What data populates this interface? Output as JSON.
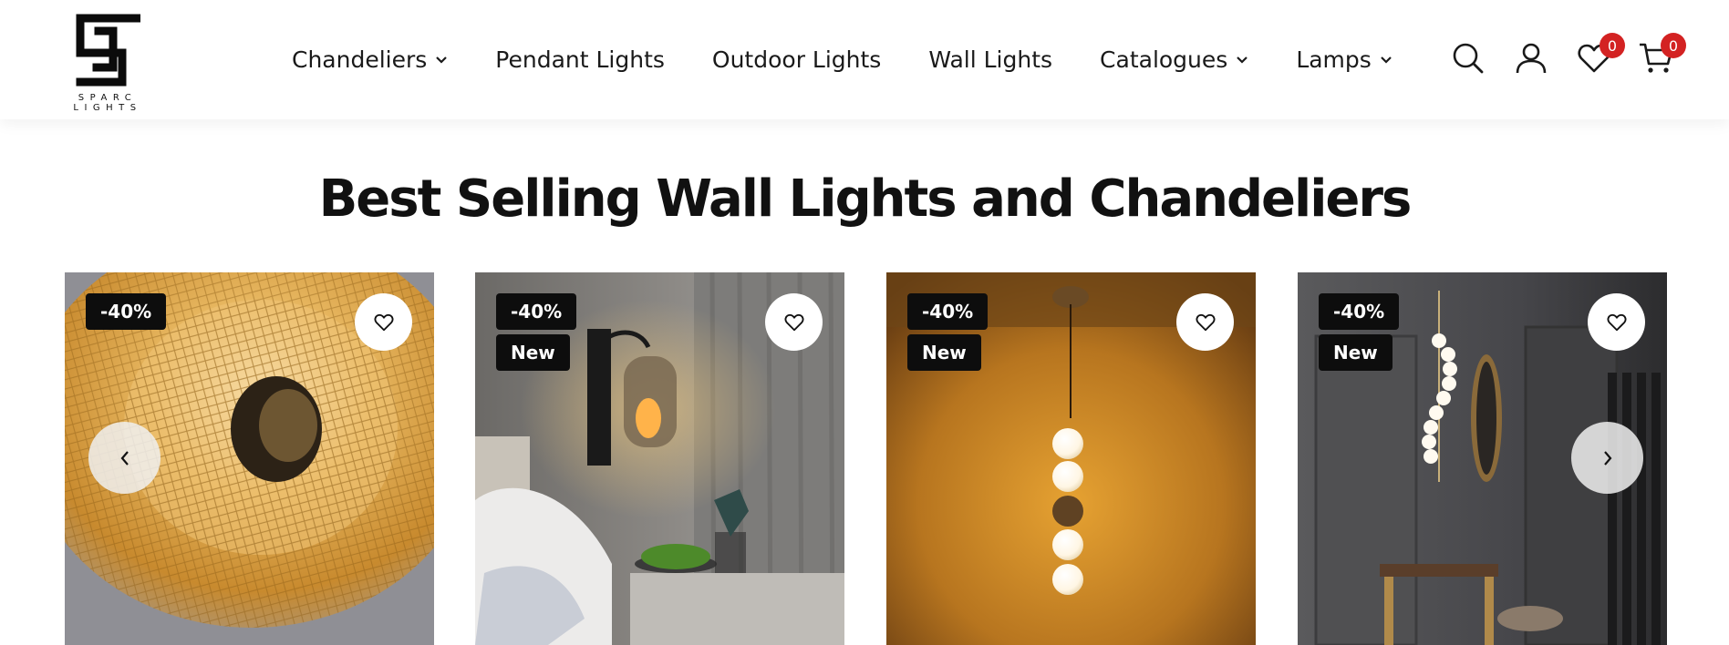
{
  "brand": {
    "name": "SPARC LIGHTS"
  },
  "nav": {
    "items": [
      {
        "label": "Chandeliers",
        "has_dropdown": true
      },
      {
        "label": "Pendant Lights",
        "has_dropdown": false
      },
      {
        "label": "Outdoor Lights",
        "has_dropdown": false
      },
      {
        "label": "Wall Lights",
        "has_dropdown": false
      },
      {
        "label": "Catalogues",
        "has_dropdown": true
      },
      {
        "label": "Lamps",
        "has_dropdown": true
      }
    ]
  },
  "header_icons": {
    "search": "search-icon",
    "account": "user-icon",
    "wishlist": "heart-icon",
    "wishlist_count": "0",
    "cart": "cart-icon",
    "cart_count": "0"
  },
  "section": {
    "title": "Best Selling Wall Lights and Chandeliers"
  },
  "products": [
    {
      "discount": "-40%",
      "badge": "",
      "wishlist_icon": "heart-icon"
    },
    {
      "discount": "-40%",
      "badge": "New",
      "wishlist_icon": "heart-icon"
    },
    {
      "discount": "-40%",
      "badge": "New",
      "wishlist_icon": "heart-icon"
    },
    {
      "discount": "-40%",
      "badge": "New",
      "wishlist_icon": "heart-icon"
    }
  ],
  "slider": {
    "prev_icon": "chevron-left-icon",
    "next_icon": "chevron-right-icon"
  },
  "colors": {
    "badge_bg": "#0d0d0d",
    "count_badge": "#d32222",
    "text": "#111111"
  }
}
